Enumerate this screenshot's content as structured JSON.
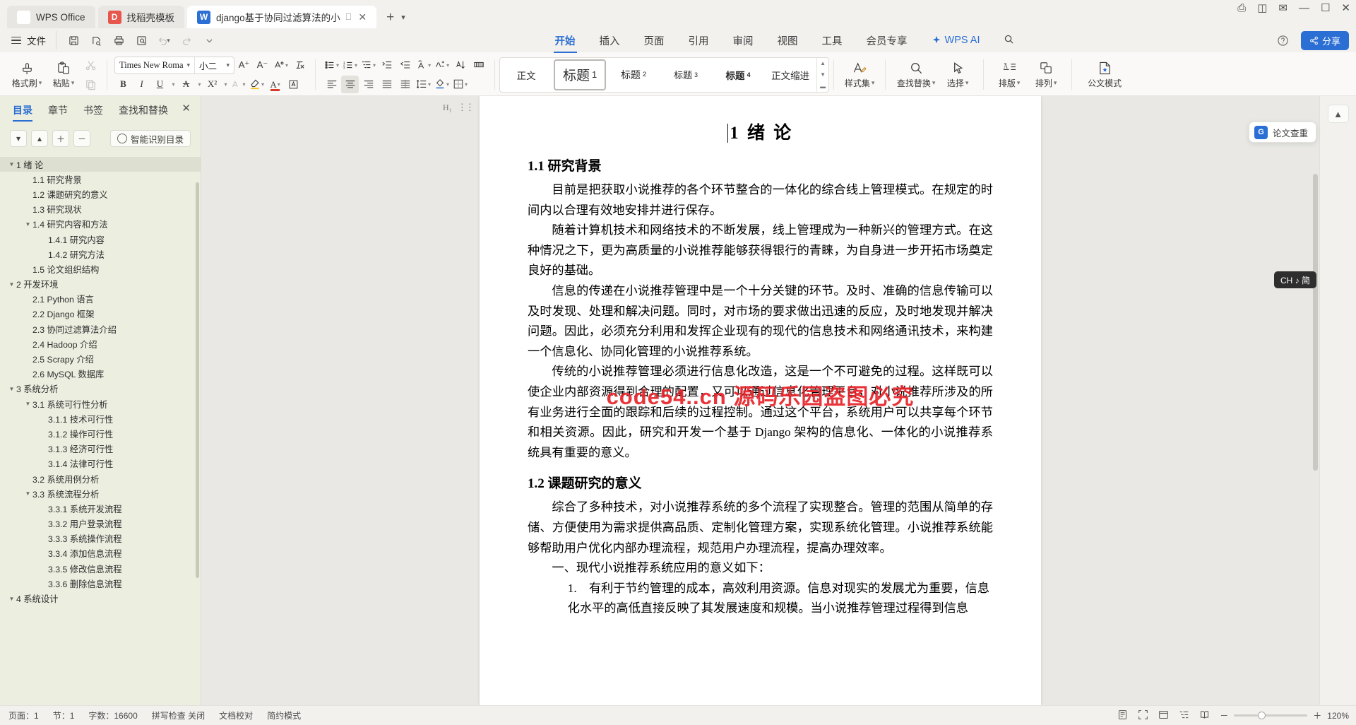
{
  "window": {
    "tabs": [
      {
        "label": "WPS Office",
        "icon": "wps-logo-icon",
        "type": "home"
      },
      {
        "label": "找稻壳模板",
        "icon": "docer-icon",
        "type": "docer"
      },
      {
        "label": "django基于协同过滤算法的小",
        "icon": "word-doc-icon",
        "type": "doc",
        "active": true
      }
    ],
    "new_tab_label": "+",
    "controls": [
      "restore-icon",
      "grid-icon",
      "mail-icon",
      "minimize-icon",
      "maximize-icon",
      "close-icon"
    ]
  },
  "menubar": {
    "file_label": "文件",
    "quick_access": [
      "save-icon",
      "save-as-icon",
      "print-icon",
      "print-preview-icon",
      "undo-icon",
      "redo-icon",
      "customize-icon"
    ],
    "tabs": [
      {
        "label": "开始",
        "active": true
      },
      {
        "label": "插入",
        "active": false
      },
      {
        "label": "页面",
        "active": false
      },
      {
        "label": "引用",
        "active": false
      },
      {
        "label": "审阅",
        "active": false
      },
      {
        "label": "视图",
        "active": false
      },
      {
        "label": "工具",
        "active": false
      },
      {
        "label": "会员专享",
        "active": false
      }
    ],
    "ai_label": "WPS AI",
    "search_icon": "search-icon",
    "help_icon": "help-icon",
    "share_label": "分享"
  },
  "ribbon": {
    "format_painter": "格式刷",
    "paste": "粘贴",
    "cut_icon": "scissors-icon",
    "copy_icon": "copy-icon",
    "font_name": "Times New Roma",
    "font_size": "小二",
    "grow_font": "A⁺",
    "shrink_font": "A⁻",
    "bold": "B",
    "italic": "I",
    "underline": "U",
    "strikethrough": "A",
    "superscript": "X²",
    "subscript": "A",
    "highlight": "pen-highlight-icon",
    "font_color": "A",
    "clear_format": "A",
    "bullets_icon": "bullet-list-icon",
    "numbering_icon": "numbered-list-icon",
    "multilevel_icon": "multilevel-list-icon",
    "indent_decrease_icon": "decrease-indent-icon",
    "indent_increase_icon": "increase-indent-icon",
    "pinyin_icon": "pinyin-guide-icon",
    "charborder_icon": "char-border-icon",
    "sort_icon": "sort-icon",
    "showmarks_icon": "show-marks-icon",
    "align_left_icon": "align-left-icon",
    "align_center_icon": "align-center-icon",
    "align_right_icon": "align-right-icon",
    "align_justify_icon": "align-justify-icon",
    "distribute_icon": "distribute-icon",
    "line_spacing_icon": "line-spacing-icon",
    "shading_icon": "shading-icon",
    "borders_icon": "borders-icon",
    "styles": [
      {
        "label": "正文",
        "selected": false
      },
      {
        "label": "标题",
        "num": "1",
        "selected": true
      },
      {
        "label": "标题",
        "num": "2",
        "selected": false
      },
      {
        "label": "标题",
        "num": "3",
        "selected": false
      },
      {
        "label": "标题",
        "num": "4",
        "selected": false
      },
      {
        "label": "正文缩进",
        "selected": false
      }
    ],
    "right_tools": [
      {
        "label": "样式集",
        "icon": "style-set-icon",
        "caret": true
      },
      {
        "label": "查找替换",
        "icon": "search-icon",
        "caret": true
      },
      {
        "label": "选择",
        "icon": "cursor-select-icon",
        "caret": true
      },
      {
        "label": "排版",
        "icon": "typeset-icon",
        "caret": true
      },
      {
        "label": "排列",
        "icon": "arrange-icon",
        "caret": true
      },
      {
        "label": "公文模式",
        "icon": "official-doc-icon",
        "caret": false
      }
    ]
  },
  "navpane": {
    "tabs": [
      {
        "label": "目录",
        "active": true
      },
      {
        "label": "章节",
        "active": false
      },
      {
        "label": "书签",
        "active": false
      },
      {
        "label": "查找和替换",
        "active": false
      }
    ],
    "close_icon": "close-icon",
    "tools": [
      {
        "icon": "chevron-down-icon",
        "name": "expand-down-button"
      },
      {
        "icon": "chevron-up-icon",
        "name": "collapse-up-button"
      },
      {
        "icon": "plus-icon",
        "name": "increase-level-button"
      },
      {
        "icon": "minus-icon",
        "name": "decrease-level-button"
      }
    ],
    "smart_toc_label": "智能识别目录",
    "items": [
      {
        "text": "1 绪   论",
        "level": 1,
        "tri": "▼",
        "selected": true
      },
      {
        "text": "1.1 研究背景",
        "level": 2,
        "tri": ""
      },
      {
        "text": "1.2 课题研究的意义",
        "level": 2,
        "tri": ""
      },
      {
        "text": "1.3 研究现状",
        "level": 2,
        "tri": ""
      },
      {
        "text": "1.4 研究内容和方法",
        "level": 2,
        "tri": "▼"
      },
      {
        "text": "1.4.1 研究内容",
        "level": 3,
        "tri": ""
      },
      {
        "text": "1.4.2 研究方法",
        "level": 3,
        "tri": ""
      },
      {
        "text": "1.5 论文组织结构",
        "level": 2,
        "tri": ""
      },
      {
        "text": "2 开发环境",
        "level": 1,
        "tri": "▼"
      },
      {
        "text": "2.1 Python 语言",
        "level": 2,
        "tri": ""
      },
      {
        "text": "2.2 Django 框架",
        "level": 2,
        "tri": ""
      },
      {
        "text": "2.3 协同过滤算法介绍",
        "level": 2,
        "tri": ""
      },
      {
        "text": "2.4 Hadoop 介绍",
        "level": 2,
        "tri": ""
      },
      {
        "text": "2.5 Scrapy 介绍",
        "level": 2,
        "tri": ""
      },
      {
        "text": "2.6 MySQL 数据库",
        "level": 2,
        "tri": ""
      },
      {
        "text": "3 系统分析",
        "level": 1,
        "tri": "▼"
      },
      {
        "text": "3.1  系统可行性分析",
        "level": 2,
        "tri": "▼"
      },
      {
        "text": "3.1.1  技术可行性",
        "level": 3,
        "tri": ""
      },
      {
        "text": "3.1.2  操作可行性",
        "level": 3,
        "tri": ""
      },
      {
        "text": "3.1.3  经济可行性",
        "level": 3,
        "tri": ""
      },
      {
        "text": "3.1.4  法律可行性",
        "level": 3,
        "tri": ""
      },
      {
        "text": "3.2  系统用例分析",
        "level": 2,
        "tri": ""
      },
      {
        "text": "3.3 系统流程分析",
        "level": 2,
        "tri": "▼"
      },
      {
        "text": "3.3.1  系统开发流程",
        "level": 3,
        "tri": ""
      },
      {
        "text": "3.3.2  用户登录流程",
        "level": 3,
        "tri": ""
      },
      {
        "text": "3.3.3  系统操作流程",
        "level": 3,
        "tri": ""
      },
      {
        "text": "3.3.4  添加信息流程",
        "level": 3,
        "tri": ""
      },
      {
        "text": "3.3.5  修改信息流程",
        "level": 3,
        "tri": ""
      },
      {
        "text": "3.3.6  删除信息流程",
        "level": 3,
        "tri": ""
      },
      {
        "text": "4 系统设计",
        "level": 1,
        "tri": "▼"
      }
    ]
  },
  "document": {
    "heading_mark": "H₁",
    "title": "1 绪   论",
    "sections": [
      {
        "heading": "1.1 研究背景",
        "paragraphs": [
          "目前是把获取小说推荐的各个环节整合的一体化的综合线上管理模式。在规定的时间内以合理有效地安排并进行保存。",
          "随着计算机技术和网络技术的不断发展，线上管理成为一种新兴的管理方式。在这种情况之下，更为高质量的小说推荐能够获得银行的青睐，为自身进一步开拓市场奠定良好的基础。",
          "信息的传递在小说推荐管理中是一个十分关键的环节。及时、准确的信息传输可以及时发现、处理和解决问题。同时，对市场的要求做出迅速的反应，及时地发现并解决问题。因此，必须充分利用和发挥企业现有的现代的信息技术和网络通讯技术，来构建一个信息化、协同化管理的小说推荐系统。",
          "传统的小说推荐管理必须进行信息化改造，这是一个不可避免的过程。这样既可以使企业内部资源得到合理的配置，又可以通过信息化管理平台，对小说推荐所涉及的所有业务进行全面的跟踪和后续的过程控制。通过这个平台，系统用户可以共享每个环节和相关资源。因此，研究和开发一个基于 Django 架构的信息化、一体化的小说推荐系统具有重要的意义。"
        ]
      },
      {
        "heading": "1.2 课题研究的意义",
        "paragraphs": [
          "综合了多种技术，对小说推荐系统的多个流程了实现整合。管理的范围从简单的存储、方便使用为需求提供高品质、定制化管理方案，实现系统化管理。小说推荐系统能够帮助用户优化内部办理流程，规范用户办理流程，提高办理效率。",
          "一、现代小说推荐系统应用的意义如下："
        ],
        "list": [
          "1.　有利于节约管理的成本，高效利用资源。信息对现实的发展尤为重要，信息化水平的高低直接反映了其发展速度和规模。当小说推荐管理过程得到信息"
        ]
      }
    ],
    "watermark": "code54..cn 源码乐园盗图必究"
  },
  "rightrail": {
    "collapse_icon": "collapse-ribbon-icon",
    "check_label": "论文查重",
    "check_badge": "G",
    "ime_text": "CH  ♪ 简"
  },
  "statusbar": {
    "page_info": "页面：1",
    "section_info": "节：1",
    "word_count": "字数：16600",
    "spellcheck": "拼写检查 关闭",
    "doc_proof": "文档校对",
    "typeset": "简约模式",
    "zoom_percent": "120%",
    "view_icons": [
      "print-layout-icon",
      "full-screen-icon",
      "web-layout-icon",
      "outline-icon",
      "read-icon"
    ],
    "zoom_minus": "－",
    "zoom_plus": "＋"
  },
  "colors": {
    "accent": "#2b6fd4",
    "watermark": "#e8232a",
    "navpane_bg": "#eceee0",
    "ribbon_bg": "#faf9f7",
    "chrome_bg": "#f2f1ee"
  }
}
